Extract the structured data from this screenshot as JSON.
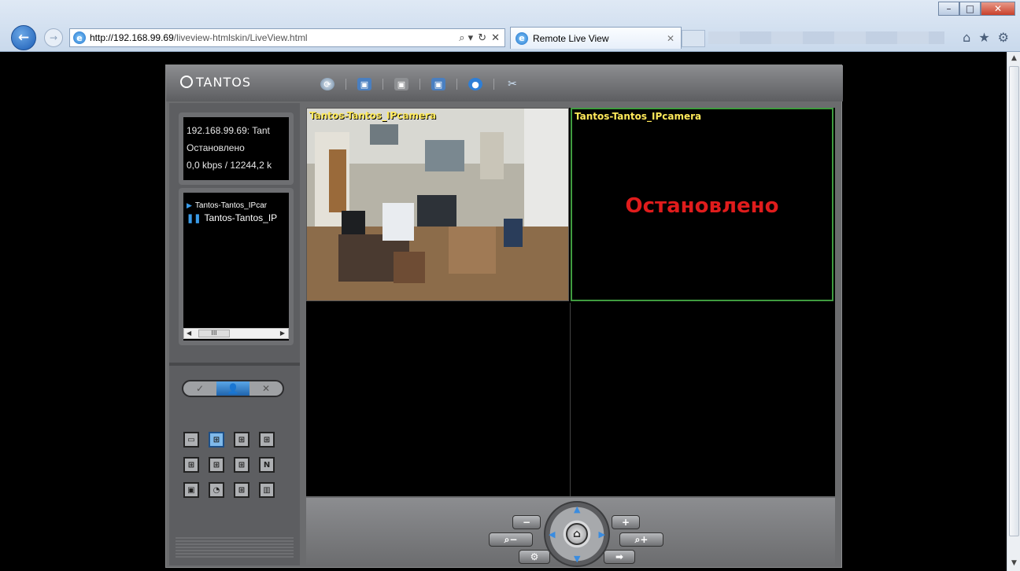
{
  "browser": {
    "url_host": "http://192.168.99.69",
    "url_path": "/liveview-htmlskin/LiveView.html",
    "tab_title": "Remote Live View",
    "search_glyph": "⌕ ▾",
    "refresh_glyph": "↻",
    "stop_glyph": "✕",
    "window_controls": {
      "minimize": "–",
      "maximize": "□",
      "close": "✕"
    }
  },
  "app": {
    "brand": "TANTOS",
    "info": {
      "line1": "192.168.99.69: Tant",
      "line2": "Остановлено",
      "line3": "0,0 kbps / 12244,2 k"
    },
    "channels": [
      {
        "label": "Tantos-Tantos_IPcar",
        "state": "playing"
      },
      {
        "label": "Tantos-Tantos_IP",
        "state": "paused"
      }
    ],
    "scroll_thumb_glyph": "III",
    "mode_toggle": [
      "✓",
      "👤",
      "✕"
    ],
    "layout_grid_glyph": "N"
  },
  "video": {
    "cells": [
      {
        "label": "Tantos-Tantos_IPcamera",
        "status": ""
      },
      {
        "label": "Tantos-Tantos_IPcamera",
        "status": "Остановлено"
      }
    ]
  },
  "ptz": {
    "zoom_out": "−",
    "zoom_in": "+",
    "home": "⌂"
  },
  "colors": {
    "selected_cell_border": "#3f9b3f",
    "camera_label": "#ffe95a",
    "stopped_text": "#e01c1c",
    "accent_blue": "#3a9be8"
  }
}
